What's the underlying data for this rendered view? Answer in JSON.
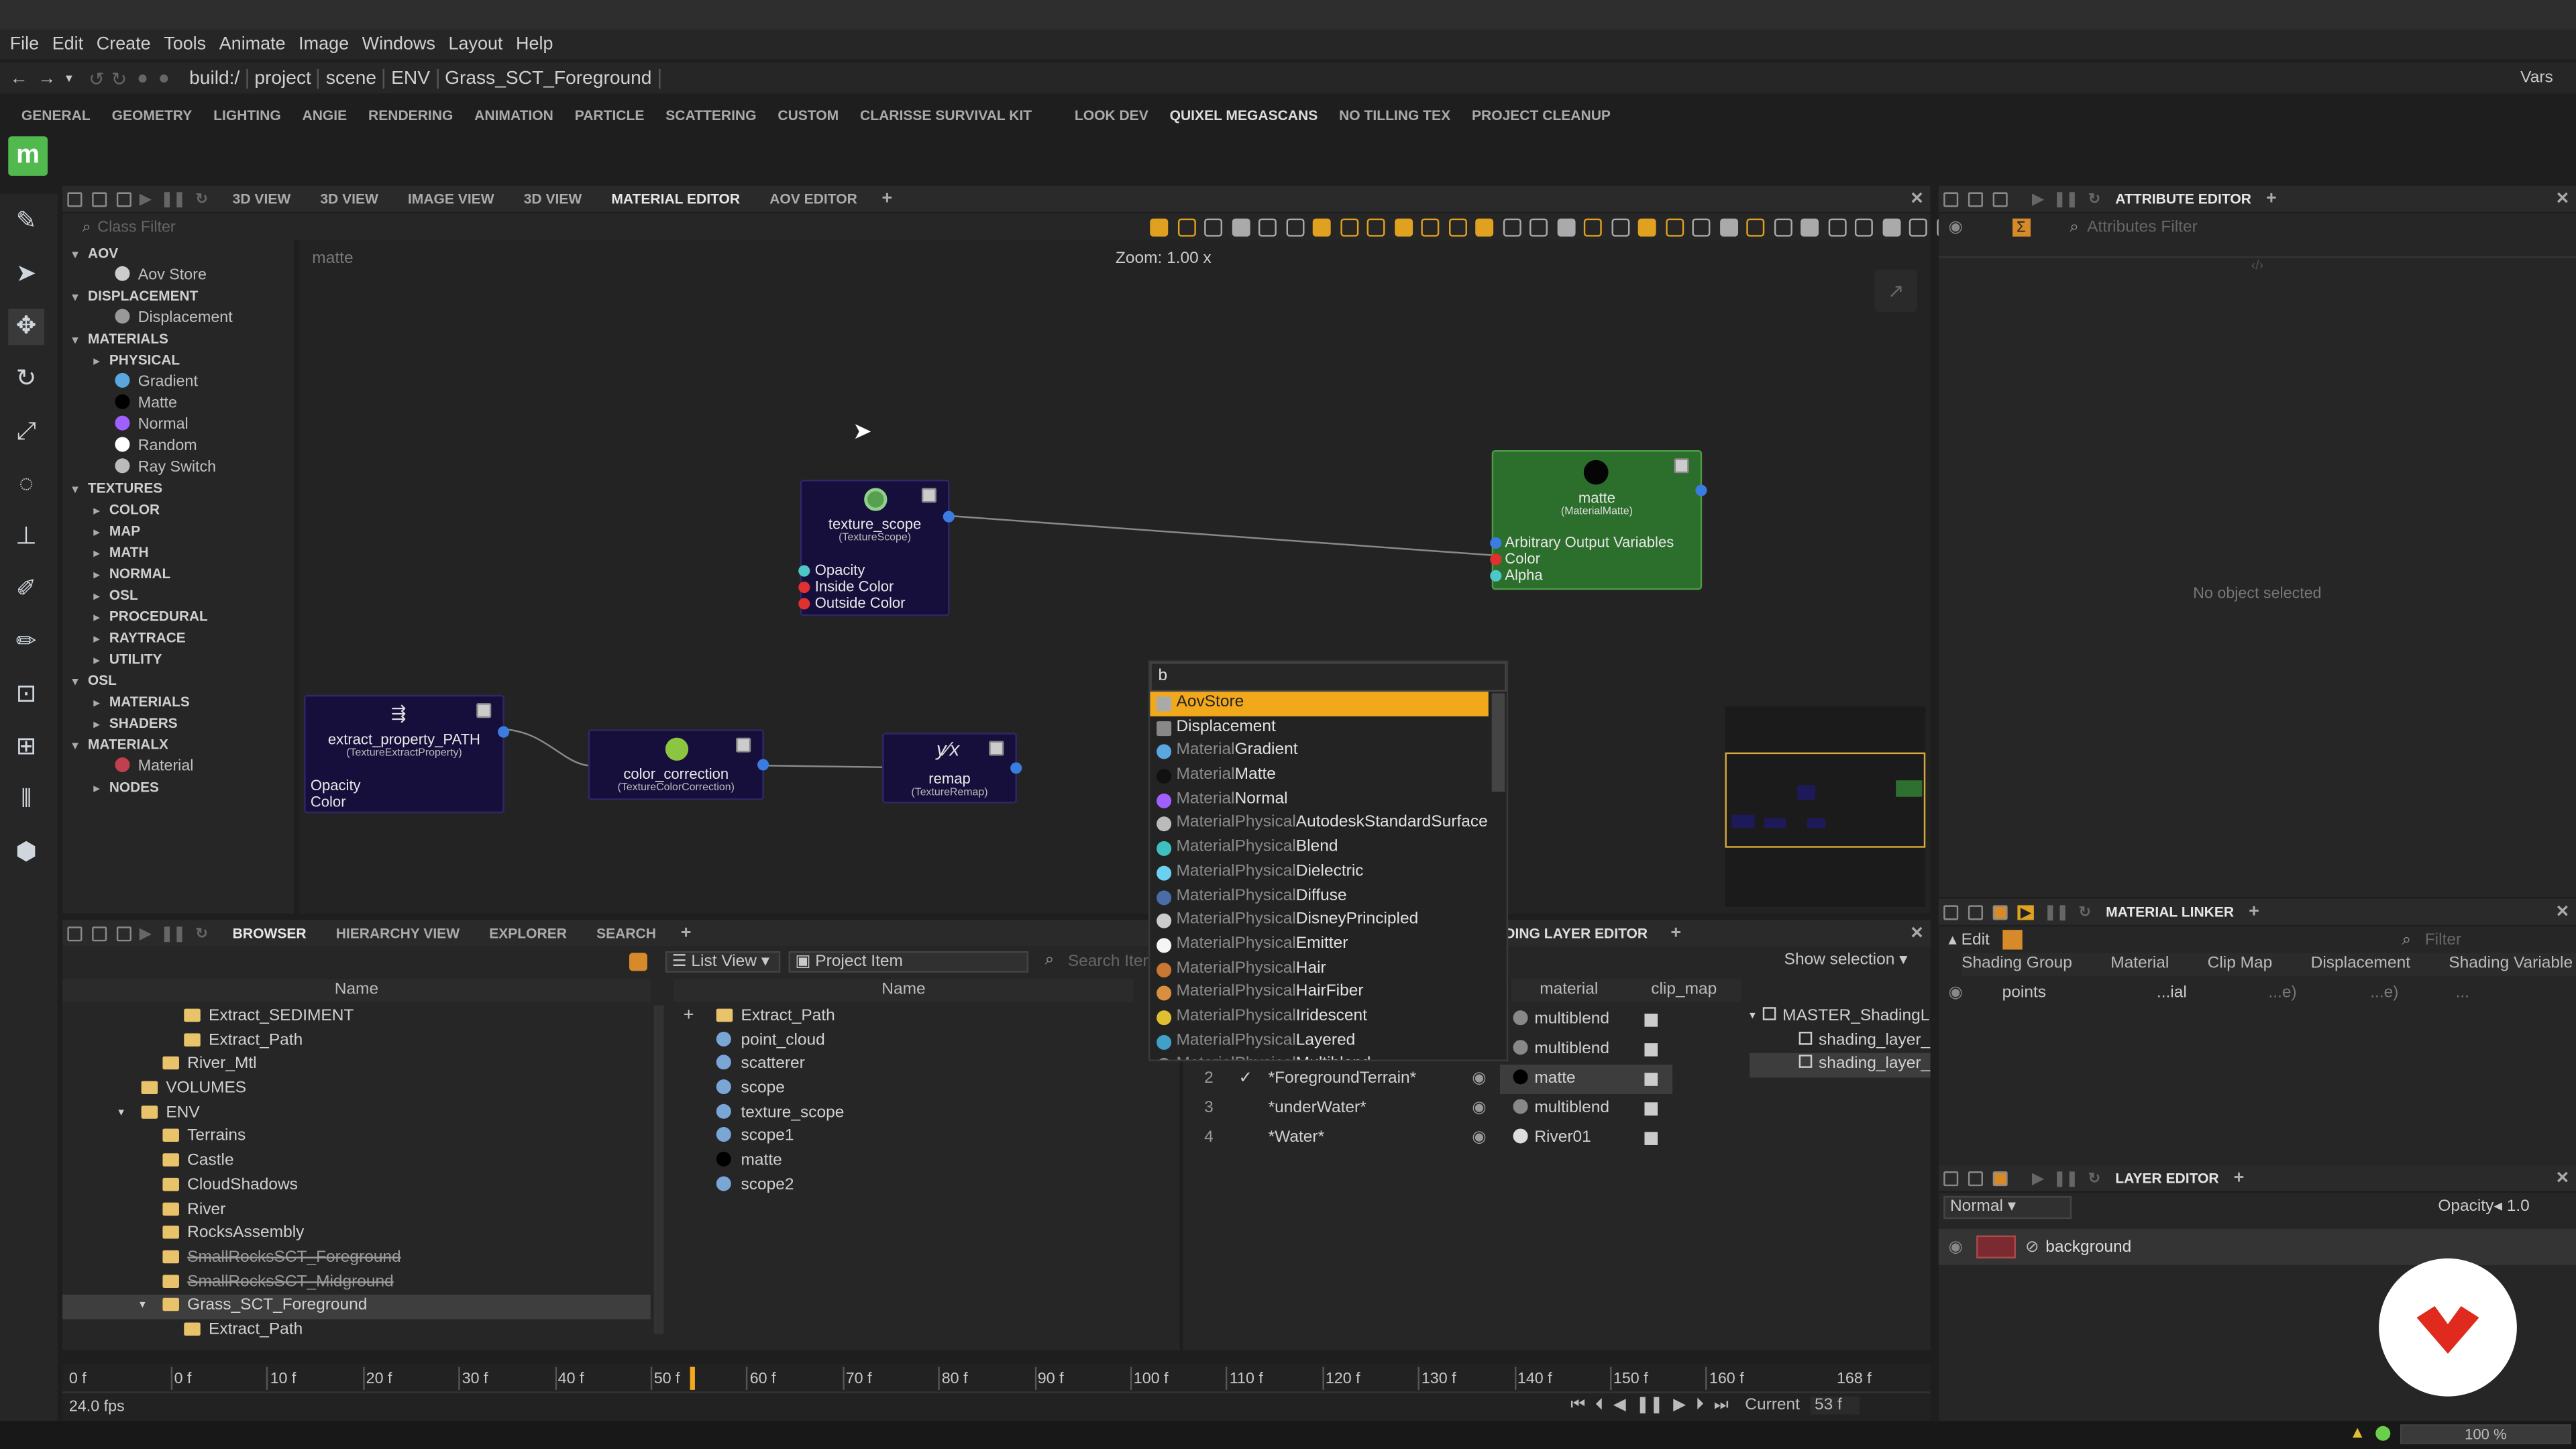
{
  "menu": [
    "File",
    "Edit",
    "Create",
    "Tools",
    "Animate",
    "Image",
    "Windows",
    "Layout",
    "Help"
  ],
  "path": {
    "crumbs": [
      "build:/",
      "project",
      "scene",
      "ENV",
      "Grass_SCT_Foreground"
    ],
    "vars": "Vars"
  },
  "shelf": [
    "GENERAL",
    "GEOMETRY",
    "LIGHTING",
    "ANGIE",
    "RENDERING",
    "ANIMATION",
    "PARTICLE",
    "SCATTERING",
    "CUSTOM",
    "CLARISSE SURVIVAL KIT",
    "LOOK DEV",
    "QUIXEL MEGASCANS",
    "NO TILLING TEX",
    "PROJECT CLEANUP"
  ],
  "viewtabs": [
    "3D VIEW",
    "3D VIEW",
    "IMAGE VIEW",
    "3D VIEW",
    "MATERIAL EDITOR",
    "AOV EDITOR"
  ],
  "classfilter": "Class Filter",
  "tree": [
    {
      "t": "AOV",
      "k": "section",
      "i": 0
    },
    {
      "t": "Aov Store",
      "k": "leaf",
      "i": 2
    },
    {
      "t": "DISPLACEMENT",
      "k": "section",
      "i": 0
    },
    {
      "t": "Displacement",
      "k": "leaf",
      "i": 2
    },
    {
      "t": "MATERIALS",
      "k": "section",
      "i": 0
    },
    {
      "t": "PHYSICAL",
      "k": "section",
      "i": 1
    },
    {
      "t": "Gradient",
      "k": "leaf",
      "i": 2
    },
    {
      "t": "Matte",
      "k": "leaf",
      "i": 2
    },
    {
      "t": "Normal",
      "k": "leaf",
      "i": 2
    },
    {
      "t": "Random",
      "k": "leaf",
      "i": 2
    },
    {
      "t": "Ray Switch",
      "k": "leaf",
      "i": 2
    },
    {
      "t": "TEXTURES",
      "k": "section",
      "i": 0
    },
    {
      "t": "COLOR",
      "k": "section",
      "i": 1
    },
    {
      "t": "MAP",
      "k": "section",
      "i": 1
    },
    {
      "t": "MATH",
      "k": "section",
      "i": 1
    },
    {
      "t": "NORMAL",
      "k": "section",
      "i": 1
    },
    {
      "t": "OSL",
      "k": "section",
      "i": 1
    },
    {
      "t": "PROCEDURAL",
      "k": "section",
      "i": 1
    },
    {
      "t": "RAYTRACE",
      "k": "section",
      "i": 1
    },
    {
      "t": "UTILITY",
      "k": "section",
      "i": 1
    },
    {
      "t": "OSL",
      "k": "section",
      "i": 0
    },
    {
      "t": "MATERIALS",
      "k": "section",
      "i": 1
    },
    {
      "t": "SHADERS",
      "k": "section",
      "i": 1
    },
    {
      "t": "MATERIALX",
      "k": "section",
      "i": 0
    },
    {
      "t": "Material",
      "k": "leaf",
      "i": 2
    },
    {
      "t": "NODES",
      "k": "section",
      "i": 1
    }
  ],
  "graph": {
    "context": "matte",
    "zoom": "Zoom: 1.00 x",
    "search": "b",
    "nodes": {
      "texture_scope": {
        "name": "texture_scope",
        "type": "(TextureScope)",
        "ports": [
          "Opacity",
          "Inside Color",
          "Outside Color"
        ]
      },
      "matte": {
        "name": "matte",
        "type": "(MaterialMatte)",
        "ports": [
          "Arbitrary Output Variables",
          "Color",
          "Alpha"
        ]
      },
      "extract": {
        "name": "extract_property_PATH",
        "type": "(TextureExtractProperty)",
        "ports": [
          "Opacity",
          "Color"
        ]
      },
      "cc": {
        "name": "color_correction",
        "type": "(TextureColorCorrection)"
      },
      "remap": {
        "name": "remap",
        "type": "(TextureRemap)"
      }
    }
  },
  "dropdown": [
    {
      "pre": "",
      "t": "AovStore",
      "c": "#aaaaaa"
    },
    {
      "pre": "",
      "t": "Displacement",
      "c": "#888888"
    },
    {
      "pre": "Material",
      "t": "Gradient",
      "c": "#5aa7e0"
    },
    {
      "pre": "Material",
      "t": "Matte",
      "c": "#111111"
    },
    {
      "pre": "Material",
      "t": "Normal",
      "c": "#a060ff"
    },
    {
      "pre": "MaterialPhysical",
      "t": "AutodeskStandardSurface",
      "c": "#bbbbbb"
    },
    {
      "pre": "MaterialPhysical",
      "t": "Blend",
      "c": "#3fc0c0"
    },
    {
      "pre": "MaterialPhysical",
      "t": "Dielectric",
      "c": "#6cd0f0"
    },
    {
      "pre": "MaterialPhysical",
      "t": "Diffuse",
      "c": "#4a6da8"
    },
    {
      "pre": "MaterialPhysical",
      "t": "DisneyPrincipled",
      "c": "#cccccc"
    },
    {
      "pre": "MaterialPhysical",
      "t": "Emitter",
      "c": "#f5f5f5"
    },
    {
      "pre": "MaterialPhysical",
      "t": "Hair",
      "c": "#c87832"
    },
    {
      "pre": "MaterialPhysical",
      "t": "HairFiber",
      "c": "#d89040"
    },
    {
      "pre": "MaterialPhysical",
      "t": "Iridescent",
      "c": "#e0c030"
    },
    {
      "pre": "MaterialPhysical",
      "t": "Layered",
      "c": "#40a0c8"
    },
    {
      "pre": "MaterialPhysical",
      "t": "Multiblend",
      "c": "#999999"
    }
  ],
  "browser": {
    "tabs": [
      "BROWSER",
      "HIERARCHY VIEW",
      "EXPLORER",
      "SEARCH"
    ],
    "listview": "List View",
    "projectitem": "Project Item",
    "searchitem": "Search Item",
    "namehdr": "Name",
    "left": [
      {
        "t": "Extract_SEDIMENT",
        "d": 4,
        "s": false,
        "sel": false
      },
      {
        "t": "Extract_Path",
        "d": 4,
        "s": false,
        "sel": false
      },
      {
        "t": "River_Mtl",
        "d": 3,
        "s": false,
        "sel": false
      },
      {
        "t": "VOLUMES",
        "d": 2,
        "s": false,
        "sel": false
      },
      {
        "t": "ENV",
        "d": 2,
        "s": false,
        "sel": false
      },
      {
        "t": "Terrains",
        "d": 3,
        "s": false,
        "sel": false
      },
      {
        "t": "Castle",
        "d": 3,
        "s": false,
        "sel": false
      },
      {
        "t": "CloudShadows",
        "d": 3,
        "s": false,
        "sel": false
      },
      {
        "t": "River",
        "d": 3,
        "s": false,
        "sel": false
      },
      {
        "t": "RocksAssembly",
        "d": 3,
        "s": false,
        "sel": false
      },
      {
        "t": "SmallRocksSCT_Foreground",
        "d": 3,
        "s": true,
        "sel": false
      },
      {
        "t": "SmallRocksSCT_Midground",
        "d": 3,
        "s": true,
        "sel": false
      },
      {
        "t": "Grass_SCT_Foreground",
        "d": 3,
        "s": false,
        "sel": true
      },
      {
        "t": "Extract_Path",
        "d": 4,
        "s": false,
        "sel": false
      }
    ],
    "items": [
      "Extract_Path",
      "point_cloud",
      "scatterer",
      "scope",
      "texture_scope",
      "scope1",
      "matte",
      "scope2"
    ]
  },
  "layer": {
    "title": "DING LAYER EDITOR",
    "showsel": "Show selection",
    "cols": [
      "material",
      "clip_map"
    ],
    "mats": [
      "multiblend",
      "multiblend",
      "matte",
      "multiblend",
      "River01"
    ],
    "rows": [
      {
        "n": "2",
        "t": "*ForegroundTerrain*"
      },
      {
        "n": "3",
        "t": "*underWater*"
      },
      {
        "n": "4",
        "t": "*Water*"
      }
    ],
    "tree": [
      "MASTER_ShadingL",
      "shading_layer_",
      "shading_layer_"
    ]
  },
  "attr": {
    "title": "ATTRIBUTE EDITOR",
    "filter": "Attributes Filter",
    "empty": "No object selected"
  },
  "linker": {
    "title": "MATERIAL LINKER",
    "edit": "Edit",
    "filter": "Filter",
    "cols": [
      "Shading Group",
      "Material",
      "Clip Map",
      "Displacement",
      "Shading Variable"
    ],
    "row": "points",
    "mat": "...ial",
    "clip": "...e)",
    "disp": "...e)",
    "var": "..."
  },
  "layers": {
    "title": "LAYER EDITOR",
    "mode": "Normal",
    "opacity": "Opacity",
    "opval": "1.0",
    "bg": "background"
  },
  "timeline": {
    "ticks": [
      "0 f",
      "10 f",
      "20 f",
      "30 f",
      "40 f",
      "50 f",
      "60 f",
      "70 f",
      "80 f",
      "90 f",
      "100 f",
      "110 f",
      "120 f",
      "130 f",
      "140 f",
      "150 f",
      "160 f"
    ],
    "start": "0 f",
    "end": "168 f",
    "fps": "24.0 fps",
    "current": "Current",
    "curval": "53 f",
    "percent": "100 %"
  }
}
